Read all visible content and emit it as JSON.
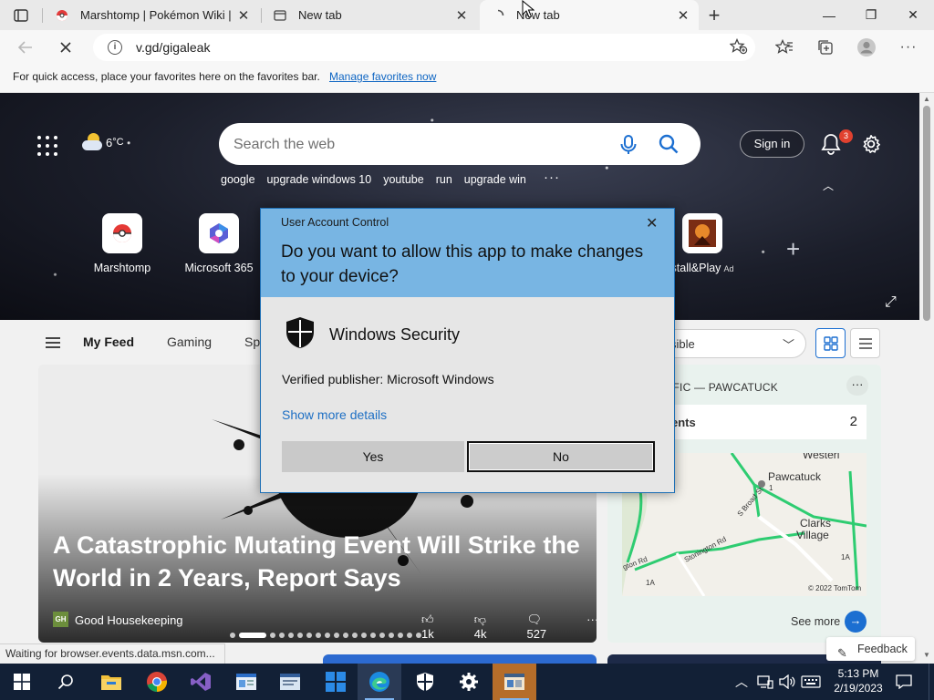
{
  "browser": {
    "tabs": [
      {
        "title": "Marshtomp | Pokémon Wiki | Far",
        "close": "✕"
      },
      {
        "title": "New tab",
        "close": "✕"
      },
      {
        "title": "New tab",
        "close": "✕",
        "active": true,
        "loading": true
      }
    ],
    "new_tab": "+",
    "window_controls": {
      "minimize": "—",
      "maximize": "❐",
      "close": "✕"
    },
    "url": "v.gd/gigaleak",
    "favorites_bar": {
      "message": "For quick access, place your favorites here on the favorites bar.",
      "link": "Manage favorites now"
    }
  },
  "newtab": {
    "weather": {
      "temp": "6",
      "unit": "°C"
    },
    "search_placeholder": "Search the web",
    "sign_in": "Sign in",
    "notification_count": "3",
    "trending": [
      "google",
      "upgrade windows 10",
      "youtube",
      "run",
      "upgrade win"
    ],
    "more": "···",
    "quick_links": [
      {
        "label": "Marshtomp"
      },
      {
        "label": "Microsoft 365"
      },
      {
        "label": "stall&Play",
        "ad": "Ad"
      }
    ],
    "feed_tabs": [
      "My Feed",
      "Gaming",
      "Sp"
    ],
    "visibility_select": "sible",
    "hero": {
      "headline": "A Catastrophic Mutating Event Will Strike the World in 2 Years, Report Says",
      "source_logo": "GH",
      "source": "Good Housekeeping",
      "likes": "1k",
      "dislikes": "4k",
      "comments": "527",
      "more": "···"
    },
    "traffic": {
      "title": "FFIC — PAWCATUCK",
      "row_label": "ents",
      "row_count": "2",
      "more": "···",
      "map_labels": [
        "Westerl",
        "Pawcatuck",
        "Clarks",
        "Village",
        "Stonington Rd",
        "S Broad St",
        "gton Rd",
        "1A",
        "1A",
        "1",
        "© 2022 TomTom"
      ],
      "see_more": "See more"
    },
    "feedback": "Feedback",
    "status": "Waiting for browser.events.data.msn.com..."
  },
  "uac": {
    "caption": "User Account Control",
    "question": "Do you want to allow this app to make changes to your device?",
    "app_name": "Windows Security",
    "publisher": "Verified publisher: Microsoft Windows",
    "details_link": "Show more details",
    "yes": "Yes",
    "no": "No"
  },
  "taskbar": {
    "time": "5:13 PM",
    "date": "2/19/2023",
    "tray_chevron": "^"
  },
  "colors": {
    "uac_header": "#78b5e3",
    "taskbar": "#122036",
    "link_blue": "#0f66c3",
    "accent": "#1c6fd1"
  }
}
